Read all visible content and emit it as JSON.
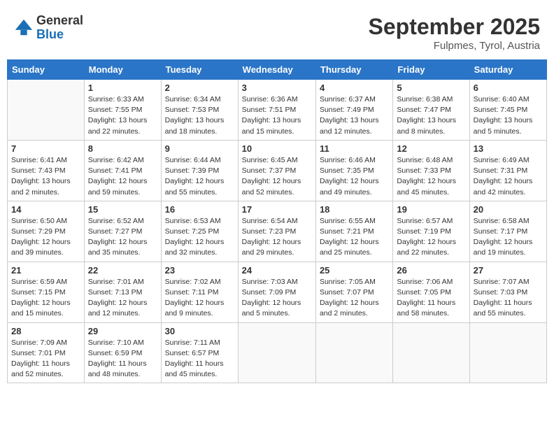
{
  "header": {
    "logo_general": "General",
    "logo_blue": "Blue",
    "month_title": "September 2025",
    "location": "Fulpmes, Tyrol, Austria"
  },
  "days_of_week": [
    "Sunday",
    "Monday",
    "Tuesday",
    "Wednesday",
    "Thursday",
    "Friday",
    "Saturday"
  ],
  "weeks": [
    [
      {
        "day": "",
        "sunrise": "",
        "sunset": "",
        "daylight": ""
      },
      {
        "day": "1",
        "sunrise": "Sunrise: 6:33 AM",
        "sunset": "Sunset: 7:55 PM",
        "daylight": "Daylight: 13 hours and 22 minutes."
      },
      {
        "day": "2",
        "sunrise": "Sunrise: 6:34 AM",
        "sunset": "Sunset: 7:53 PM",
        "daylight": "Daylight: 13 hours and 18 minutes."
      },
      {
        "day": "3",
        "sunrise": "Sunrise: 6:36 AM",
        "sunset": "Sunset: 7:51 PM",
        "daylight": "Daylight: 13 hours and 15 minutes."
      },
      {
        "day": "4",
        "sunrise": "Sunrise: 6:37 AM",
        "sunset": "Sunset: 7:49 PM",
        "daylight": "Daylight: 13 hours and 12 minutes."
      },
      {
        "day": "5",
        "sunrise": "Sunrise: 6:38 AM",
        "sunset": "Sunset: 7:47 PM",
        "daylight": "Daylight: 13 hours and 8 minutes."
      },
      {
        "day": "6",
        "sunrise": "Sunrise: 6:40 AM",
        "sunset": "Sunset: 7:45 PM",
        "daylight": "Daylight: 13 hours and 5 minutes."
      }
    ],
    [
      {
        "day": "7",
        "sunrise": "Sunrise: 6:41 AM",
        "sunset": "Sunset: 7:43 PM",
        "daylight": "Daylight: 13 hours and 2 minutes."
      },
      {
        "day": "8",
        "sunrise": "Sunrise: 6:42 AM",
        "sunset": "Sunset: 7:41 PM",
        "daylight": "Daylight: 12 hours and 59 minutes."
      },
      {
        "day": "9",
        "sunrise": "Sunrise: 6:44 AM",
        "sunset": "Sunset: 7:39 PM",
        "daylight": "Daylight: 12 hours and 55 minutes."
      },
      {
        "day": "10",
        "sunrise": "Sunrise: 6:45 AM",
        "sunset": "Sunset: 7:37 PM",
        "daylight": "Daylight: 12 hours and 52 minutes."
      },
      {
        "day": "11",
        "sunrise": "Sunrise: 6:46 AM",
        "sunset": "Sunset: 7:35 PM",
        "daylight": "Daylight: 12 hours and 49 minutes."
      },
      {
        "day": "12",
        "sunrise": "Sunrise: 6:48 AM",
        "sunset": "Sunset: 7:33 PM",
        "daylight": "Daylight: 12 hours and 45 minutes."
      },
      {
        "day": "13",
        "sunrise": "Sunrise: 6:49 AM",
        "sunset": "Sunset: 7:31 PM",
        "daylight": "Daylight: 12 hours and 42 minutes."
      }
    ],
    [
      {
        "day": "14",
        "sunrise": "Sunrise: 6:50 AM",
        "sunset": "Sunset: 7:29 PM",
        "daylight": "Daylight: 12 hours and 39 minutes."
      },
      {
        "day": "15",
        "sunrise": "Sunrise: 6:52 AM",
        "sunset": "Sunset: 7:27 PM",
        "daylight": "Daylight: 12 hours and 35 minutes."
      },
      {
        "day": "16",
        "sunrise": "Sunrise: 6:53 AM",
        "sunset": "Sunset: 7:25 PM",
        "daylight": "Daylight: 12 hours and 32 minutes."
      },
      {
        "day": "17",
        "sunrise": "Sunrise: 6:54 AM",
        "sunset": "Sunset: 7:23 PM",
        "daylight": "Daylight: 12 hours and 29 minutes."
      },
      {
        "day": "18",
        "sunrise": "Sunrise: 6:55 AM",
        "sunset": "Sunset: 7:21 PM",
        "daylight": "Daylight: 12 hours and 25 minutes."
      },
      {
        "day": "19",
        "sunrise": "Sunrise: 6:57 AM",
        "sunset": "Sunset: 7:19 PM",
        "daylight": "Daylight: 12 hours and 22 minutes."
      },
      {
        "day": "20",
        "sunrise": "Sunrise: 6:58 AM",
        "sunset": "Sunset: 7:17 PM",
        "daylight": "Daylight: 12 hours and 19 minutes."
      }
    ],
    [
      {
        "day": "21",
        "sunrise": "Sunrise: 6:59 AM",
        "sunset": "Sunset: 7:15 PM",
        "daylight": "Daylight: 12 hours and 15 minutes."
      },
      {
        "day": "22",
        "sunrise": "Sunrise: 7:01 AM",
        "sunset": "Sunset: 7:13 PM",
        "daylight": "Daylight: 12 hours and 12 minutes."
      },
      {
        "day": "23",
        "sunrise": "Sunrise: 7:02 AM",
        "sunset": "Sunset: 7:11 PM",
        "daylight": "Daylight: 12 hours and 9 minutes."
      },
      {
        "day": "24",
        "sunrise": "Sunrise: 7:03 AM",
        "sunset": "Sunset: 7:09 PM",
        "daylight": "Daylight: 12 hours and 5 minutes."
      },
      {
        "day": "25",
        "sunrise": "Sunrise: 7:05 AM",
        "sunset": "Sunset: 7:07 PM",
        "daylight": "Daylight: 12 hours and 2 minutes."
      },
      {
        "day": "26",
        "sunrise": "Sunrise: 7:06 AM",
        "sunset": "Sunset: 7:05 PM",
        "daylight": "Daylight: 11 hours and 58 minutes."
      },
      {
        "day": "27",
        "sunrise": "Sunrise: 7:07 AM",
        "sunset": "Sunset: 7:03 PM",
        "daylight": "Daylight: 11 hours and 55 minutes."
      }
    ],
    [
      {
        "day": "28",
        "sunrise": "Sunrise: 7:09 AM",
        "sunset": "Sunset: 7:01 PM",
        "daylight": "Daylight: 11 hours and 52 minutes."
      },
      {
        "day": "29",
        "sunrise": "Sunrise: 7:10 AM",
        "sunset": "Sunset: 6:59 PM",
        "daylight": "Daylight: 11 hours and 48 minutes."
      },
      {
        "day": "30",
        "sunrise": "Sunrise: 7:11 AM",
        "sunset": "Sunset: 6:57 PM",
        "daylight": "Daylight: 11 hours and 45 minutes."
      },
      {
        "day": "",
        "sunrise": "",
        "sunset": "",
        "daylight": ""
      },
      {
        "day": "",
        "sunrise": "",
        "sunset": "",
        "daylight": ""
      },
      {
        "day": "",
        "sunrise": "",
        "sunset": "",
        "daylight": ""
      },
      {
        "day": "",
        "sunrise": "",
        "sunset": "",
        "daylight": ""
      }
    ]
  ]
}
